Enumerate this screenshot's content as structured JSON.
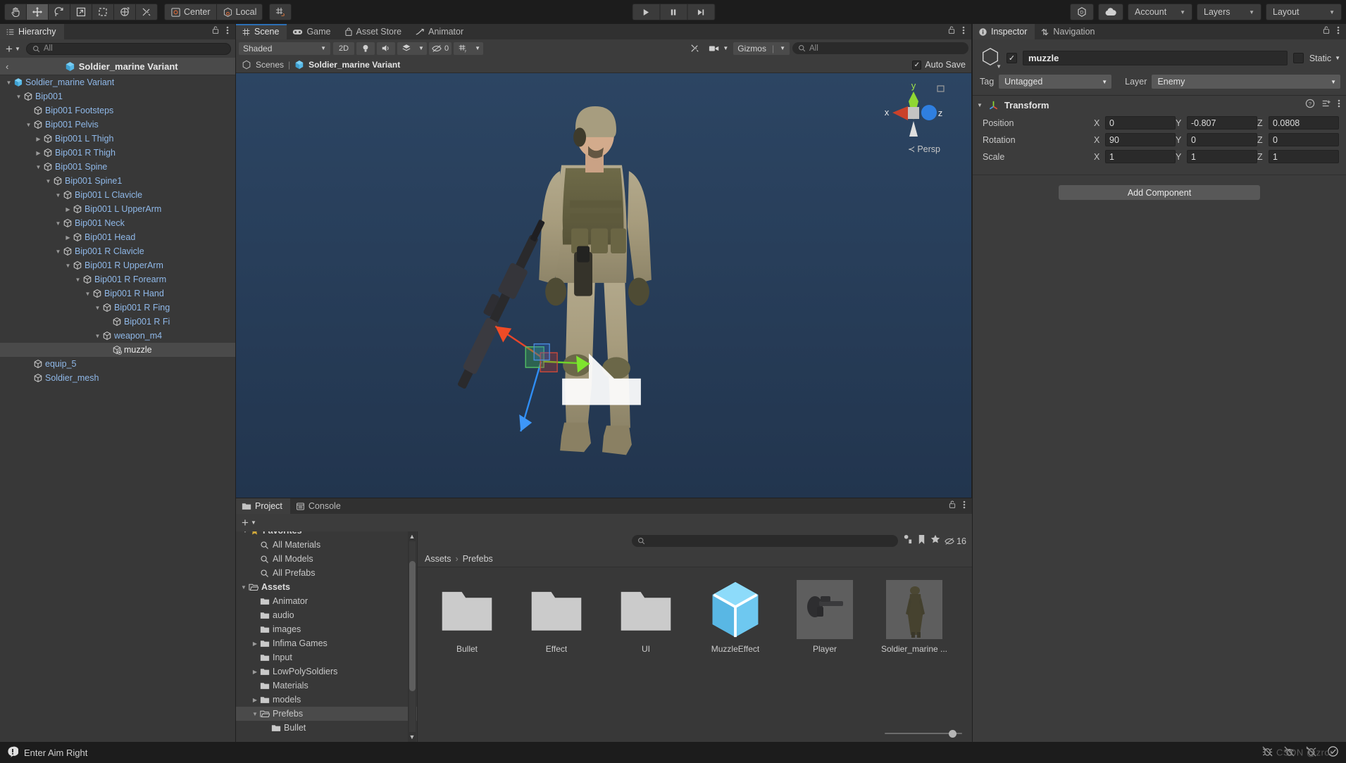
{
  "toolbar": {
    "tools": [
      {
        "name": "hand-tool",
        "title": "Hand Tool",
        "active": false
      },
      {
        "name": "move-tool",
        "title": "Move Tool",
        "active": true
      },
      {
        "name": "rotate-tool",
        "title": "Rotate Tool",
        "active": false
      },
      {
        "name": "scale-tool",
        "title": "Scale Tool",
        "active": false
      },
      {
        "name": "rect-tool",
        "title": "Rect Tool",
        "active": false
      },
      {
        "name": "transform-tool",
        "title": "Transform Tool",
        "active": false
      },
      {
        "name": "custom-tool",
        "title": "Custom Editor Tool",
        "active": false
      }
    ],
    "pivot_label": "Center",
    "handle_label": "Local",
    "play": "play",
    "pause": "pause",
    "step": "step",
    "account_label": "Account",
    "layers_label": "Layers",
    "layout_label": "Layout"
  },
  "hierarchy": {
    "tab_label": "Hierarchy",
    "search_placeholder": "All",
    "breadcrumb_title": "Soldier_marine Variant",
    "rows": [
      {
        "label": "Soldier_marine Variant",
        "depth": 0,
        "arrow": "down",
        "icon": "prefab",
        "selected": false
      },
      {
        "label": "Bip001",
        "depth": 1,
        "arrow": "down",
        "icon": "cube",
        "selected": false
      },
      {
        "label": "Bip001 Footsteps",
        "depth": 2,
        "arrow": "none",
        "icon": "cube",
        "selected": false
      },
      {
        "label": "Bip001 Pelvis",
        "depth": 2,
        "arrow": "down",
        "icon": "cube",
        "selected": false
      },
      {
        "label": "Bip001 L Thigh",
        "depth": 3,
        "arrow": "right",
        "icon": "cube",
        "selected": false
      },
      {
        "label": "Bip001 R Thigh",
        "depth": 3,
        "arrow": "right",
        "icon": "cube",
        "selected": false
      },
      {
        "label": "Bip001 Spine",
        "depth": 3,
        "arrow": "down",
        "icon": "cube",
        "selected": false
      },
      {
        "label": "Bip001 Spine1",
        "depth": 4,
        "arrow": "down",
        "icon": "cube",
        "selected": false
      },
      {
        "label": "Bip001 L Clavicle",
        "depth": 5,
        "arrow": "down",
        "icon": "cube",
        "selected": false
      },
      {
        "label": "Bip001 L UpperArm",
        "depth": 6,
        "arrow": "right",
        "icon": "cube",
        "selected": false
      },
      {
        "label": "Bip001 Neck",
        "depth": 5,
        "arrow": "down",
        "icon": "cube",
        "selected": false
      },
      {
        "label": "Bip001 Head",
        "depth": 6,
        "arrow": "right",
        "icon": "cube",
        "selected": false
      },
      {
        "label": "Bip001 R Clavicle",
        "depth": 5,
        "arrow": "down",
        "icon": "cube",
        "selected": false
      },
      {
        "label": "Bip001 R UpperArm",
        "depth": 6,
        "arrow": "down",
        "icon": "cube",
        "selected": false
      },
      {
        "label": "Bip001 R Forearm",
        "depth": 7,
        "arrow": "down",
        "icon": "cube",
        "selected": false
      },
      {
        "label": "Bip001 R Hand",
        "depth": 8,
        "arrow": "down",
        "icon": "cube",
        "selected": false
      },
      {
        "label": "Bip001 R Fing",
        "depth": 9,
        "arrow": "down",
        "icon": "cube",
        "selected": false
      },
      {
        "label": "Bip001 R Fi",
        "depth": 10,
        "arrow": "none",
        "icon": "cube",
        "selected": false
      },
      {
        "label": "weapon_m4",
        "depth": 9,
        "arrow": "down",
        "icon": "cube",
        "selected": false
      },
      {
        "label": "muzzle",
        "depth": 10,
        "arrow": "none",
        "icon": "cube-plus",
        "selected": true
      },
      {
        "label": "equip_5",
        "depth": 2,
        "arrow": "none",
        "icon": "cube",
        "selected": false
      },
      {
        "label": "Soldier_mesh",
        "depth": 2,
        "arrow": "none",
        "icon": "cube",
        "selected": false
      }
    ]
  },
  "scene": {
    "tabs": [
      {
        "label": "Scene",
        "icon": "grid-icon",
        "active": true
      },
      {
        "label": "Game",
        "icon": "gamepad-icon",
        "active": false
      },
      {
        "label": "Asset Store",
        "icon": "store-icon",
        "active": false
      },
      {
        "label": "Animator",
        "icon": "animator-icon",
        "active": false
      }
    ],
    "draw_mode": "Shaded",
    "mode_2d": "2D",
    "hidden_count": "0",
    "gizmos_label": "Gizmos",
    "search_placeholder": "All",
    "breadcrumb_scenes": "Scenes",
    "breadcrumb_prefab": "Soldier_marine Variant",
    "auto_save_label": "Auto Save",
    "auto_save_checked": true,
    "gizmo": {
      "x": "x",
      "y": "y",
      "z": "z",
      "projection": "Persp"
    }
  },
  "project": {
    "tabs": [
      {
        "label": "Project",
        "icon": "folder-icon",
        "active": true
      },
      {
        "label": "Console",
        "icon": "console-icon",
        "active": false
      }
    ],
    "search_placeholder": "",
    "asset_count": "16",
    "breadcrumb": [
      "Assets",
      "Prefebs"
    ],
    "tree": [
      {
        "label": "All Materials",
        "depth": 1,
        "arrow": "none",
        "icon": "search",
        "selected": false,
        "bold": false
      },
      {
        "label": "All Models",
        "depth": 1,
        "arrow": "none",
        "icon": "search",
        "selected": false,
        "bold": false
      },
      {
        "label": "All Prefabs",
        "depth": 1,
        "arrow": "none",
        "icon": "search",
        "selected": false,
        "bold": false
      },
      {
        "label": "Assets",
        "depth": 0,
        "arrow": "down",
        "icon": "folder-open",
        "selected": false,
        "bold": true
      },
      {
        "label": "Animator",
        "depth": 1,
        "arrow": "none",
        "icon": "folder",
        "selected": false,
        "bold": false
      },
      {
        "label": "audio",
        "depth": 1,
        "arrow": "none",
        "icon": "folder",
        "selected": false,
        "bold": false
      },
      {
        "label": "images",
        "depth": 1,
        "arrow": "none",
        "icon": "folder",
        "selected": false,
        "bold": false
      },
      {
        "label": "Infima Games",
        "depth": 1,
        "arrow": "right",
        "icon": "folder",
        "selected": false,
        "bold": false
      },
      {
        "label": "Input",
        "depth": 1,
        "arrow": "none",
        "icon": "folder",
        "selected": false,
        "bold": false
      },
      {
        "label": "LowPolySoldiers",
        "depth": 1,
        "arrow": "right",
        "icon": "folder",
        "selected": false,
        "bold": false
      },
      {
        "label": "Materials",
        "depth": 1,
        "arrow": "none",
        "icon": "folder",
        "selected": false,
        "bold": false
      },
      {
        "label": "models",
        "depth": 1,
        "arrow": "right",
        "icon": "folder",
        "selected": false,
        "bold": false
      },
      {
        "label": "Prefebs",
        "depth": 1,
        "arrow": "down",
        "icon": "folder-open",
        "selected": true,
        "bold": false
      },
      {
        "label": "Bullet",
        "depth": 2,
        "arrow": "none",
        "icon": "folder",
        "selected": false,
        "bold": false
      }
    ],
    "assets": [
      {
        "label": "Bullet",
        "kind": "folder"
      },
      {
        "label": "Effect",
        "kind": "folder"
      },
      {
        "label": "UI",
        "kind": "folder"
      },
      {
        "label": "MuzzleEffect",
        "kind": "prefab"
      },
      {
        "label": "Player",
        "kind": "thumb-gun"
      },
      {
        "label": "Soldier_marine ...",
        "kind": "thumb-soldier"
      }
    ]
  },
  "inspector": {
    "tabs": [
      {
        "label": "Inspector",
        "icon": "info-icon",
        "active": true
      },
      {
        "label": "Navigation",
        "icon": "navigation-icon",
        "active": false
      }
    ],
    "object_name": "muzzle",
    "object_enabled": true,
    "static_label": "Static",
    "static_checked": false,
    "tag_label": "Tag",
    "tag_value": "Untagged",
    "layer_label": "Layer",
    "layer_value": "Enemy",
    "component_title": "Transform",
    "transform": {
      "rows": [
        {
          "label": "Position",
          "x": "0",
          "y": "-0.807",
          "z": "0.0808"
        },
        {
          "label": "Rotation",
          "x": "90",
          "y": "0",
          "z": "0"
        },
        {
          "label": "Scale",
          "x": "1",
          "y": "1",
          "z": "1"
        }
      ],
      "axis_labels": [
        "X",
        "Y",
        "Z"
      ]
    },
    "add_component_label": "Add Component"
  },
  "status": {
    "message": "Enter Aim Right",
    "watermark": "CSDN @zror"
  },
  "colors": {
    "accent_blue": "#2c6fb5",
    "panel_bg": "#383838",
    "toolbar_bg": "#3c3c3c",
    "scene_bg": "#27405c",
    "prefab_blue": "#8fb8e8",
    "selection": "#4a4a4a"
  }
}
